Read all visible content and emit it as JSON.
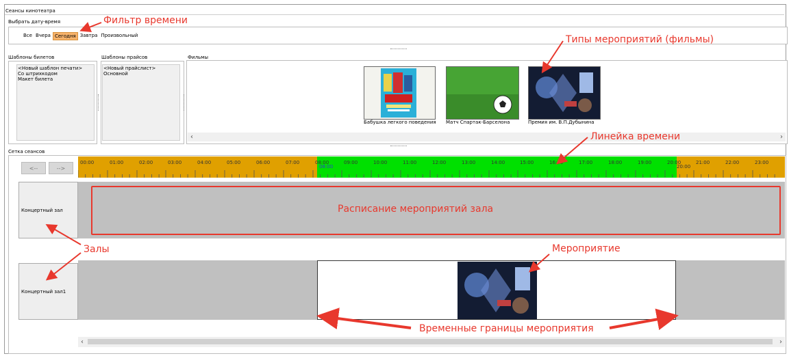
{
  "window": {
    "title": "Сеансы кинотеатра"
  },
  "filter": {
    "group_label": "Выбрать дату-время",
    "items": [
      {
        "label": "Все",
        "active": false
      },
      {
        "label": "Вчера",
        "active": false
      },
      {
        "label": "Сегодня",
        "active": true
      },
      {
        "label": "Завтра",
        "active": false
      },
      {
        "label": "Произвольный",
        "active": false
      }
    ]
  },
  "ticket_templates": {
    "label": "Шаблоны билетов",
    "items": [
      "<Новый шаблон печати>",
      "Со штрихкодом",
      "Макет билета"
    ]
  },
  "price_templates": {
    "label": "Шаблоны прайсов",
    "items": [
      "<Новый прайслист>",
      "Основной"
    ]
  },
  "films": {
    "label": "Фильмы",
    "items": [
      {
        "title": "Бабушка легкого поведения",
        "icon": "poster-comedy"
      },
      {
        "title": "Матч Спартак-Барселона",
        "icon": "poster-football"
      },
      {
        "title": "Премия им. В.П.Дубынина",
        "icon": "poster-award"
      }
    ]
  },
  "grid": {
    "label": "Сетка сеансов",
    "prev_label": "<--",
    "next_label": "-->",
    "hours": [
      "00:00",
      "01:00",
      "02:00",
      "03:00",
      "04:00",
      "05:00",
      "06:00",
      "07:00",
      "08:00",
      "09:00",
      "10:00",
      "11:00",
      "12:00",
      "13:00",
      "14:00",
      "15:00",
      "16:00",
      "17:00",
      "18:00",
      "19:00",
      "20:00",
      "21:00",
      "22:00",
      "23:00"
    ],
    "active_start_label": "08:00",
    "active_end_label": "20:00",
    "colors": {
      "inactive": "#e0a000",
      "active": "#00e000",
      "schedule_bg": "#c0c0c0"
    },
    "halls": [
      "Концертный зал",
      "Концертный зал1"
    ]
  },
  "annotations": {
    "time_filter": "Фильтр времени",
    "event_types": "Типы мероприятий (фильмы)",
    "timeline": "Линейка времени",
    "hall_schedule": "Расписание мероприятий зала",
    "halls": "Залы",
    "event": "Мероприятие",
    "event_bounds": "Временные границы мероприятия"
  }
}
